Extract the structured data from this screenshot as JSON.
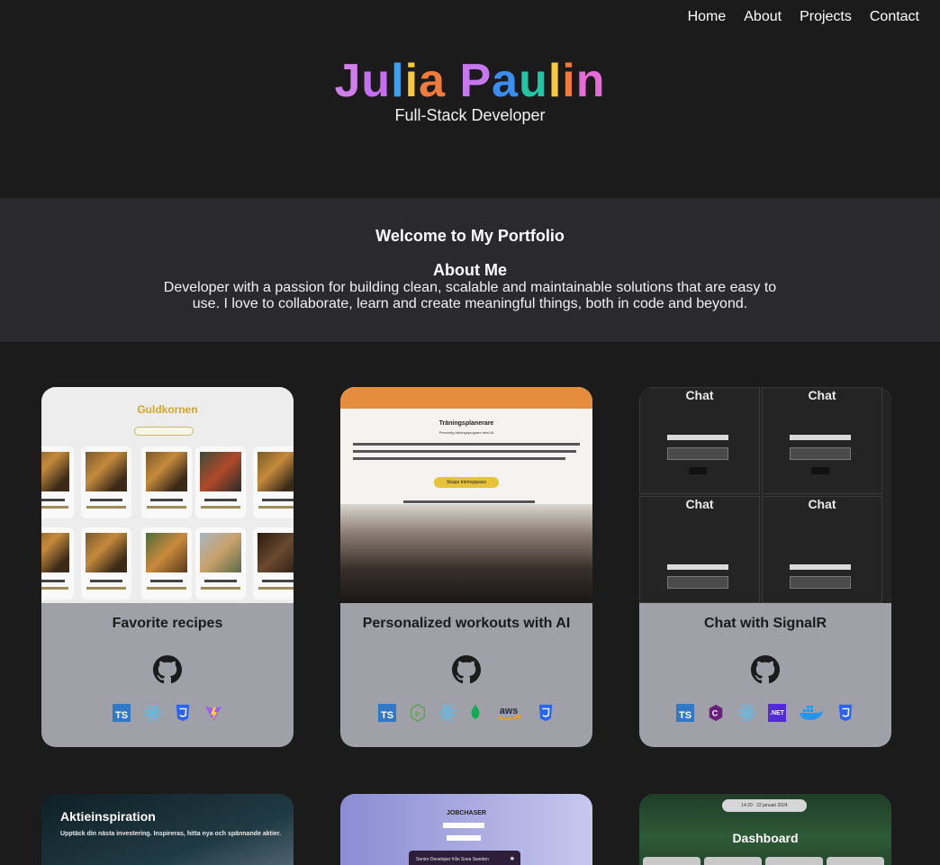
{
  "nav": {
    "items": [
      "Home",
      "About",
      "Projects",
      "Contact"
    ]
  },
  "hero": {
    "name_letters": [
      {
        "ch": "J",
        "color": "#d07ee8"
      },
      {
        "ch": "u",
        "color": "#c76df0"
      },
      {
        "ch": "l",
        "color": "#3ba0f0"
      },
      {
        "ch": "i",
        "color": "#f7c83e"
      },
      {
        "ch": "a",
        "color": "#f07a3a"
      },
      {
        "ch": " ",
        "color": "#ffffff"
      },
      {
        "ch": "P",
        "color": "#c777ee"
      },
      {
        "ch": "a",
        "color": "#3a8ef0"
      },
      {
        "ch": "u",
        "color": "#1fc7a6"
      },
      {
        "ch": "l",
        "color": "#f7c83e"
      },
      {
        "ch": "i",
        "color": "#f07a3a"
      },
      {
        "ch": "n",
        "color": "#e66ad8"
      }
    ],
    "subtitle": "Full-Stack Developer"
  },
  "about": {
    "heading": "Welcome to My Portfolio",
    "subheading": "About Me",
    "text": "Developer with a passion for building clean, scalable and maintainable solutions that are easy to use. I love to collaborate, learn and create meaningful things, both in code and beyond."
  },
  "projects": [
    {
      "title": "Favorite recipes",
      "tech": [
        "typescript-icon",
        "react-icon",
        "css3-icon",
        "vite-icon"
      ],
      "screenshot": {
        "app_name": "Guldkornen"
      }
    },
    {
      "title": "Personalized workouts with AI",
      "tech": [
        "typescript-icon",
        "nodejs-icon",
        "react-icon",
        "mongodb-icon",
        "aws-icon",
        "css3-icon"
      ],
      "screenshot": {
        "app_name": "Träningsplanerare",
        "subtitle": "Personlig träningsprogram med AI",
        "button": "Skapa träningspass"
      }
    },
    {
      "title": "Chat with SignalR",
      "tech": [
        "typescript-icon",
        "csharp-icon",
        "react-icon",
        "dotnet-icon",
        "docker-icon",
        "css3-icon"
      ],
      "screenshot": {
        "heading": "Chat",
        "messages_label": "Messages:",
        "send": "Send"
      }
    }
  ],
  "more_projects": [
    {
      "title": "Aktieinspiration",
      "text": "Upptäck din nästa investering. Inspireras, hitta nya och spännande aktier."
    },
    {
      "title": "JOBCHASER",
      "card_text": "Senior Developer från Svea Sweden"
    },
    {
      "title": "Dashboard",
      "time": "14:20 · 22 januari 2024"
    }
  ],
  "icon_labels": {
    "ts": "TS",
    "aws": "aws",
    "net": ".NET"
  }
}
